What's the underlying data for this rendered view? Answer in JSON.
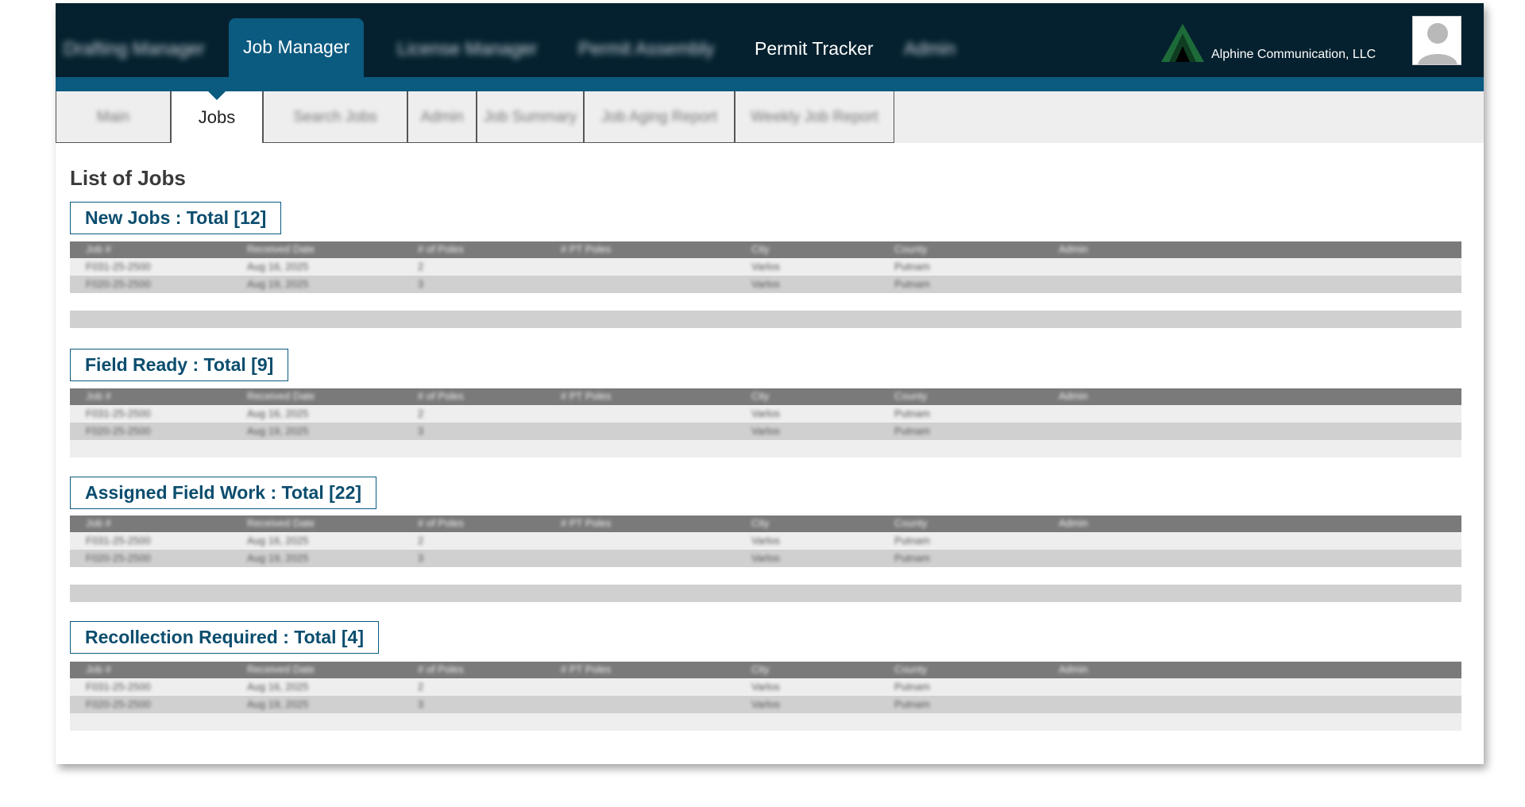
{
  "nav": {
    "items": [
      {
        "label": "Drafting Manager"
      },
      {
        "label": "Job Manager"
      },
      {
        "label": "License Manager"
      },
      {
        "label": "Permit Assembly"
      },
      {
        "label": "Permit Tracker"
      },
      {
        "label": "Admin"
      }
    ],
    "active_index": 1,
    "company": "Alphine Communication, LLC",
    "logo_icon": "mountain-logo-icon",
    "avatar_icon": "user-avatar-icon"
  },
  "tabs": [
    {
      "label": "Main"
    },
    {
      "label": "Jobs"
    },
    {
      "label": "Search Jobs"
    },
    {
      "label": "Admin"
    },
    {
      "label": "Job Summary"
    },
    {
      "label": "Job Aging Report"
    },
    {
      "label": "Weekly Job Report"
    }
  ],
  "page_title": "List of Jobs",
  "columns": [
    "Job #",
    "Received Date",
    "# of Poles",
    "# PT Poles",
    "City",
    "County",
    "Admin"
  ],
  "sections": [
    {
      "title": "New Jobs : Total [12]",
      "rows": [
        [
          "F031-25-2500",
          "Aug 16, 2025",
          "2",
          "",
          "Varlos",
          "Putnam",
          ""
        ],
        [
          "F020-25-2500",
          "Aug 19, 2025",
          "3",
          "",
          "Varlos",
          "Putnam",
          ""
        ]
      ]
    },
    {
      "title": "Field Ready : Total [9]",
      "rows": [
        [
          "F031-25-2500",
          "Aug 16, 2025",
          "2",
          "",
          "Varlos",
          "Putnam",
          ""
        ],
        [
          "F020-25-2500",
          "Aug 19, 2025",
          "3",
          "",
          "Varlos",
          "Putnam",
          ""
        ]
      ]
    },
    {
      "title": "Assigned Field Work : Total [22]",
      "rows": [
        [
          "F031-25-2500",
          "Aug 16, 2025",
          "2",
          "",
          "Varlos",
          "Putnam",
          ""
        ],
        [
          "F020-25-2500",
          "Aug 19, 2025",
          "3",
          "",
          "Varlos",
          "Putnam",
          ""
        ]
      ]
    },
    {
      "title": "Recollection Required : Total [4]",
      "rows": [
        [
          "F031-25-2500",
          "Aug 16, 2025",
          "2",
          "",
          "Varlos",
          "Putnam",
          ""
        ],
        [
          "F020-25-2500",
          "Aug 19, 2025",
          "3",
          "",
          "Varlos",
          "Putnam",
          ""
        ]
      ]
    }
  ],
  "colors": {
    "nav_bg": "#05212f",
    "accent": "#0b5a80",
    "section_text": "#0b4d6e",
    "table_header": "#7a7a7a",
    "logo_green": "#1e6b3a"
  }
}
